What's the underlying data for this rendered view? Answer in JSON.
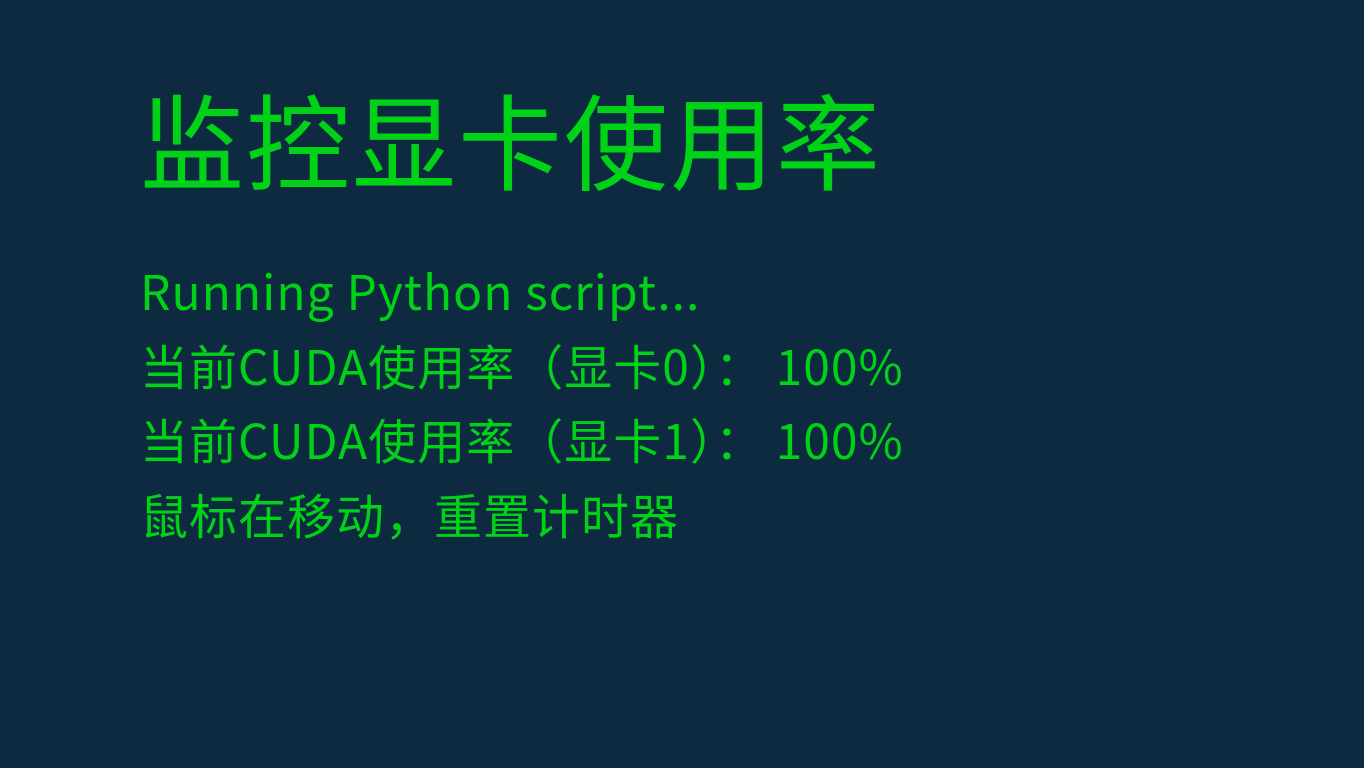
{
  "colors": {
    "background": "#0e2a40",
    "text": "#00d218"
  },
  "title": "监控显卡使用率",
  "lines": [
    "Running Python script...",
    "当前CUDA使用率（显卡0）： 100%",
    "当前CUDA使用率（显卡1）： 100%",
    "鼠标在移动，重置计时器"
  ]
}
